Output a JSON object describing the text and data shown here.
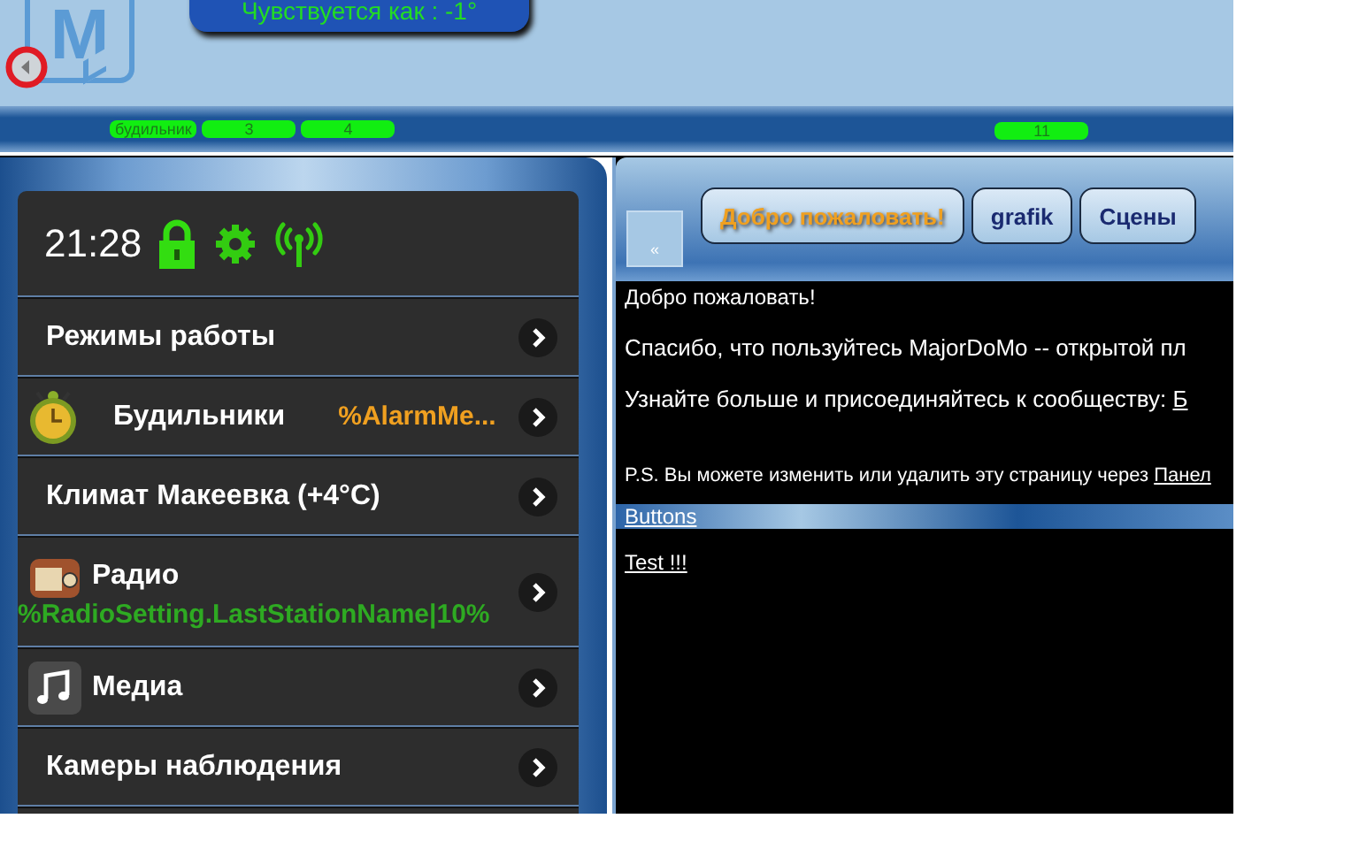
{
  "header": {
    "logo_text": "M",
    "weather": "Чувствуется как : -1°",
    "pills": [
      {
        "label": "будильник"
      },
      {
        "label": "3"
      },
      {
        "label": "4"
      },
      {
        "label": "11"
      }
    ]
  },
  "menu": {
    "time": "21:28",
    "items": [
      {
        "label": "Режимы работы",
        "kind": "plain"
      },
      {
        "label": "Будильники",
        "kind": "alarm",
        "value": "%AlarmMe..."
      },
      {
        "label": "Климат Макеевка (+4°C)",
        "kind": "plain"
      },
      {
        "label": "Радио",
        "kind": "radio",
        "subtitle": "%RadioSetting.LastStationName|10%"
      },
      {
        "label": "Медиа",
        "kind": "music"
      },
      {
        "label": "Камеры наблюдения",
        "kind": "plain"
      }
    ]
  },
  "panel": {
    "collapse": "«",
    "tabs": [
      {
        "label": "Добро пожаловать!",
        "selected": true
      },
      {
        "label": "grafik",
        "selected": false
      },
      {
        "label": "Сцены",
        "selected": false
      }
    ],
    "title": "Добро пожаловать!",
    "paragraphs": [
      {
        "text": "Спасибо, что пользуйтесь MajorDoMo -- открытой пл"
      },
      {
        "text": "Узнайте больше и присоединяйтесь к сообществу: ",
        "link": "Б"
      },
      {
        "text": "P.S. Вы можете изменить или удалить эту страницу через ",
        "link": "Панел"
      }
    ],
    "section": "Buttons",
    "button_link": "Test !!!"
  }
}
